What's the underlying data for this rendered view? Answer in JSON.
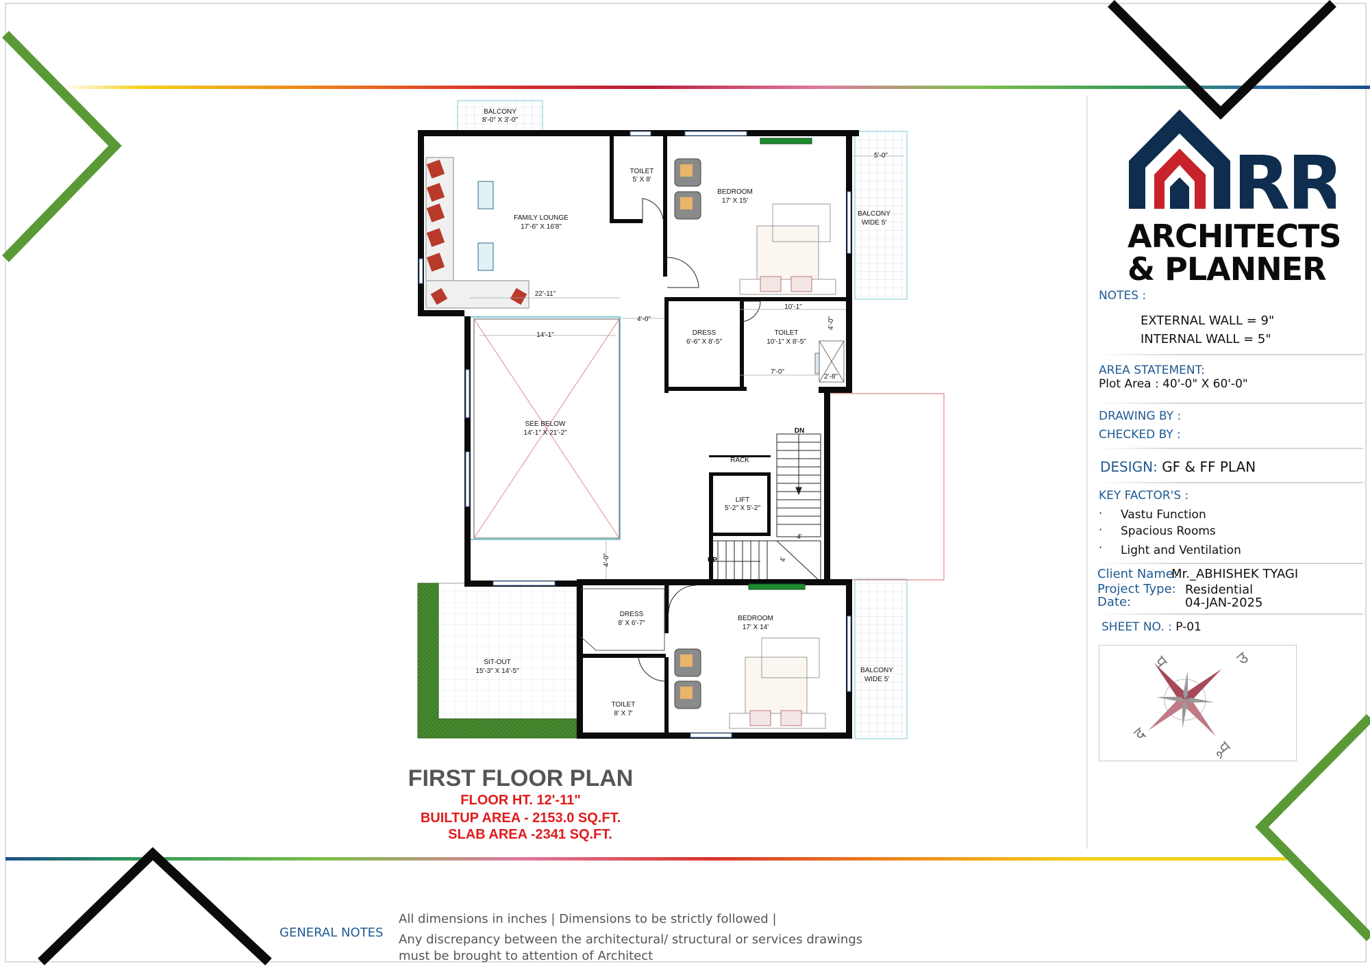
{
  "logo": {
    "mark": "RR",
    "line1": "ARCHITECTS",
    "line2": "& PLANNER"
  },
  "notes": {
    "heading": "NOTES :",
    "items": [
      "EXTERNAL WALL = 9\"",
      "INTERNAL WALL = 5\""
    ]
  },
  "area_statement": {
    "heading": "AREA STATEMENT:",
    "plot_area": "Plot Area : 40'-0\" X 60'-0\""
  },
  "drawing_by": "DRAWING BY :",
  "checked_by": "CHECKED BY :",
  "design": {
    "label": "DESIGN:",
    "value": "GF & FF PLAN"
  },
  "key_factors": {
    "heading": "KEY FACTOR'S :",
    "bullet": "·",
    "items": [
      "Vastu Function",
      "Spacious Rooms",
      "Light and Ventilation"
    ]
  },
  "client": {
    "name_label": "Client Name:",
    "name_value": "Mr._ABHISHEK TYAGI",
    "type_label": "Project Type:",
    "type_value": "Residential",
    "date_label": "Date:",
    "date_value": "04-JAN-2025"
  },
  "sheet": {
    "label": "SHEET NO. :",
    "value": "P-01"
  },
  "compass": {
    "north": "उ",
    "south": "द",
    "east": "पू",
    "west": "प"
  },
  "plan_title": {
    "title": "FIRST FLOOR PLAN",
    "floor_ht": "FLOOR HT. 12'-11\"",
    "builtup": "BUILTUP AREA - 2153.0 SQ.FT.",
    "slab": "SLAB AREA -2341 SQ.FT."
  },
  "general_notes": {
    "heading": "GENERAL NOTES",
    "line1": "All dimensions in inches | Dimensions to be strictly followed |",
    "line2": "Any discrepancy between the architectural/ structural or services drawings",
    "line3": "must be brought to attention of Architect"
  },
  "rooms": {
    "balcony_top": {
      "name": "BALCONY",
      "size": "8'-0\" X 3'-0\""
    },
    "family_lounge": {
      "name": "FAMILY LOUNGE",
      "size": "17'-6\" X 16'8\""
    },
    "toilet_top": {
      "name": "TOILET",
      "size": "5' X 8'"
    },
    "bedroom_top": {
      "name": "BEDROOM",
      "size": "17' X 15'"
    },
    "balcony_right_top": {
      "name": "BALCONY",
      "size": "WIDE 5'",
      "dim": "5'-0\""
    },
    "dress_top": {
      "name": "DRESS",
      "size": "6'-6\" X 8'-5\""
    },
    "toilet_mid": {
      "name": "TOILET",
      "size": "10'-1\" X 8'-5\""
    },
    "see_below": {
      "name": "SEE BELOW",
      "size": "14'-1\" X 21'-2\""
    },
    "rack": {
      "name": "RACK"
    },
    "lift": {
      "name": "LIFT",
      "size": "5'-2\" X 5'-2\""
    },
    "sit_out": {
      "name": "SIT-OUT",
      "size": "15'-3\" X 14'-5\""
    },
    "dress_bottom": {
      "name": "DRESS",
      "size": "8' X 6'-7\""
    },
    "toilet_bottom": {
      "name": "TOILET",
      "size": "8' X 7'"
    },
    "bedroom_bottom": {
      "name": "BEDROOM",
      "size": "17' X 14'"
    },
    "balcony_right_bottom": {
      "name": "BALCONY",
      "size": "WIDE 5'"
    }
  },
  "dims": {
    "d22_11": "22'-11\"",
    "d4_0a": "4'-0\"",
    "d14_1": "14'-1\"",
    "d10_1": "10'-1\"",
    "d4_0b": "4'-0\"",
    "d7_0": "7'-0\"",
    "d2_8": "2'-8\"",
    "d4_0c": "4'-0\"",
    "dn": "DN",
    "up": "UP",
    "d4a": "4'",
    "d4b": "4'"
  },
  "colors": {
    "green_accent": "#5a9a36",
    "navy": "#0f2d4e",
    "logo_red": "#c8222a",
    "title_red": "#e01b1b",
    "label_blue": "#1f5a93"
  }
}
